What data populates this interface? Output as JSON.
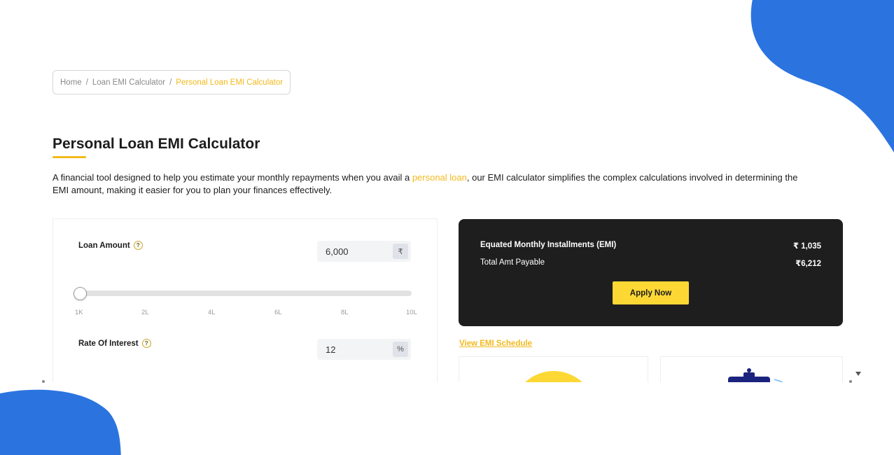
{
  "breadcrumb": {
    "items": [
      "Home",
      "Loan EMI Calculator",
      "Personal Loan EMI Calculator"
    ],
    "separator": "/"
  },
  "page": {
    "title": "Personal Loan EMI Calculator",
    "intro_before": "A financial tool designed to help you estimate your monthly repayments when you avail a ",
    "intro_link": "personal loan",
    "intro_after": ", our EMI calculator simplifies the complex calculations involved in determining the EMI amount, making it easier for you to plan your finances effectively."
  },
  "calculator": {
    "loan_amount": {
      "label": "Loan Amount",
      "help": "?",
      "value": "6,000",
      "unit": "₹",
      "slider_fraction": 0.0,
      "ticks": [
        "1K",
        "2L",
        "4L",
        "6L",
        "8L",
        "10L"
      ]
    },
    "rate_of_interest": {
      "label": "Rate Of Interest",
      "help": "?",
      "value": "12",
      "unit": "%"
    }
  },
  "summary": {
    "emi_label": "Equated Monthly Installments (EMI)",
    "emi_value": "₹ 1,035",
    "total_label": "Total Amt Payable",
    "total_value": "₹6,212",
    "apply_label": "Apply Now",
    "schedule_link": "View EMI Schedule"
  },
  "colors": {
    "accent": "#f2b91c",
    "button": "#fdd835",
    "card_dark": "#1e1e1e",
    "blob_blue": "#2b74e0"
  }
}
